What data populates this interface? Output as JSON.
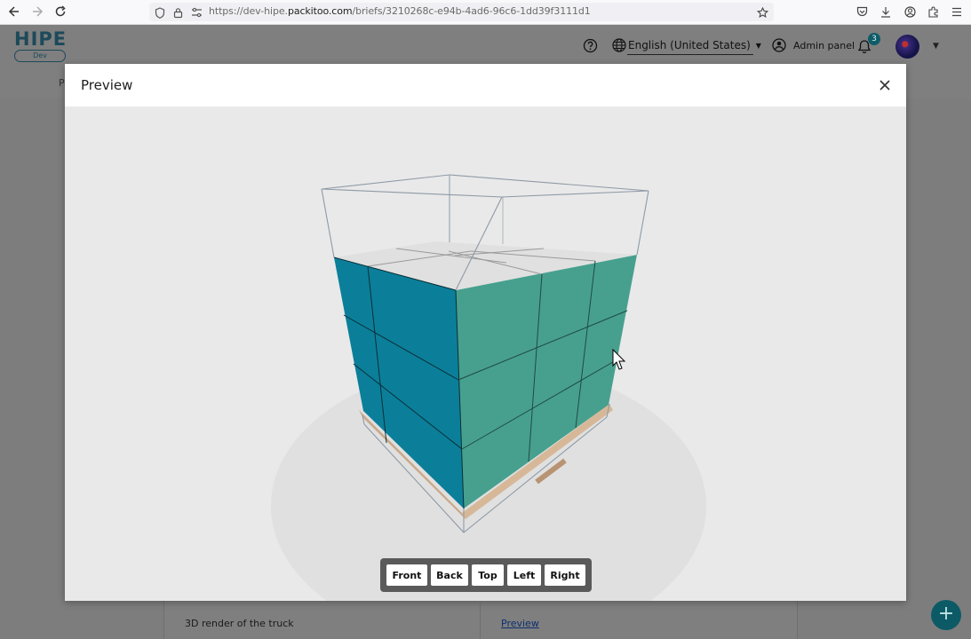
{
  "browser": {
    "url_prefix": "https://dev-hipe.",
    "url_domain": "packitoo.com",
    "url_path": "/briefs/3210268c-e94b-4ad6-96c6-1dd39f3111d1",
    "nav_icons": [
      "back-arrow-icon",
      "forward-arrow-icon",
      "reload-icon"
    ],
    "toolbar_icons": [
      "pocket-icon",
      "download-icon",
      "account-icon",
      "extensions-icon",
      "menu-icon"
    ]
  },
  "app_header": {
    "logo_text": "HIPE",
    "logo_badge": "Dev",
    "language": "English (United States)",
    "admin_label": "Admin panel",
    "notification_count": "3",
    "nav_fragment": "Pa"
  },
  "background": {
    "row_label": "3D render of the truck",
    "row_link": "Preview",
    "fab_label": "+"
  },
  "modal": {
    "title": "Preview",
    "view_buttons": [
      "Front",
      "Back",
      "Top",
      "Left",
      "Right"
    ]
  },
  "colors": {
    "box_front": "#0b7f9a",
    "box_side": "#47a08e",
    "box_top": "#e0e0e0",
    "viewer_bg": "#e9e9e9",
    "accent": "#0c5a66"
  }
}
